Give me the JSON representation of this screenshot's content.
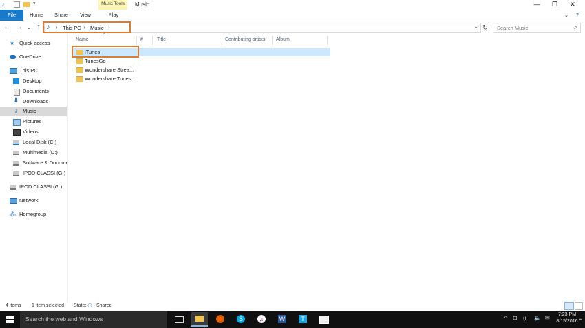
{
  "window": {
    "title": "Music",
    "contextual_tab_group": "Music Tools",
    "minimize": "—",
    "maximize": "❐",
    "close": "✕",
    "help": "?"
  },
  "ribbon": {
    "tabs": [
      {
        "label": "File"
      },
      {
        "label": "Home"
      },
      {
        "label": "Share"
      },
      {
        "label": "View"
      },
      {
        "label": "Play"
      }
    ],
    "collapse": "⌄"
  },
  "address": {
    "crumbs": [
      "This PC",
      "Music"
    ],
    "sep": "›",
    "dropdown": "⌄",
    "refresh": "↻"
  },
  "nav_buttons": {
    "back": "←",
    "forward": "→",
    "recent": "⌄",
    "up": "↑"
  },
  "search": {
    "placeholder": "Search Music",
    "icon": "⌕"
  },
  "navpane": {
    "items": [
      {
        "label": "Quick access",
        "icon": "star-icon"
      },
      {
        "label": "OneDrive",
        "icon": "cloud-icon"
      },
      {
        "label": "This PC",
        "icon": "computer-icon"
      },
      {
        "label": "Desktop",
        "icon": "desktop-icon"
      },
      {
        "label": "Documents",
        "icon": "documents-icon"
      },
      {
        "label": "Downloads",
        "icon": "downloads-icon"
      },
      {
        "label": "Music",
        "icon": "music-icon"
      },
      {
        "label": "Pictures",
        "icon": "pictures-icon"
      },
      {
        "label": "Videos",
        "icon": "videos-icon"
      },
      {
        "label": "Local Disk (C:)",
        "icon": "drive-icon"
      },
      {
        "label": "Multimedia (D:)",
        "icon": "drive-icon"
      },
      {
        "label": "Software & Docume",
        "icon": "drive-icon"
      },
      {
        "label": "IPOD CLASSI (G:)",
        "icon": "drive-icon"
      },
      {
        "label": "IPOD CLASSI (G:)",
        "icon": "drive-icon"
      },
      {
        "label": "Network",
        "icon": "network-icon"
      },
      {
        "label": "Homegroup",
        "icon": "homegroup-icon"
      }
    ]
  },
  "columns": [
    "Name",
    "#",
    "Title",
    "Contributing artists",
    "Album"
  ],
  "sort_arrow": "^",
  "files": [
    {
      "name": "iTunes"
    },
    {
      "name": "TunesGo"
    },
    {
      "name": "Wondershare Strea..."
    },
    {
      "name": "Wondershare Tunes..."
    }
  ],
  "status": {
    "count": "4 items",
    "selected": "1 item selected",
    "state_label": "State:",
    "state_value": "Shared"
  },
  "taskbar": {
    "search_placeholder": "Search the web and Windows",
    "time": "7:23 PM",
    "date": "8/15/2016",
    "tray_chevron": "^",
    "tray_icons": [
      "⊡",
      "((·",
      "🔈",
      "✉",
      "≡"
    ]
  },
  "colors": {
    "file_tab": "#1979ca",
    "highlight_box": "#e07b2e",
    "selection": "#cce8ff",
    "contextual_tab": "#fdf5b4",
    "taskbar": "#101010"
  }
}
